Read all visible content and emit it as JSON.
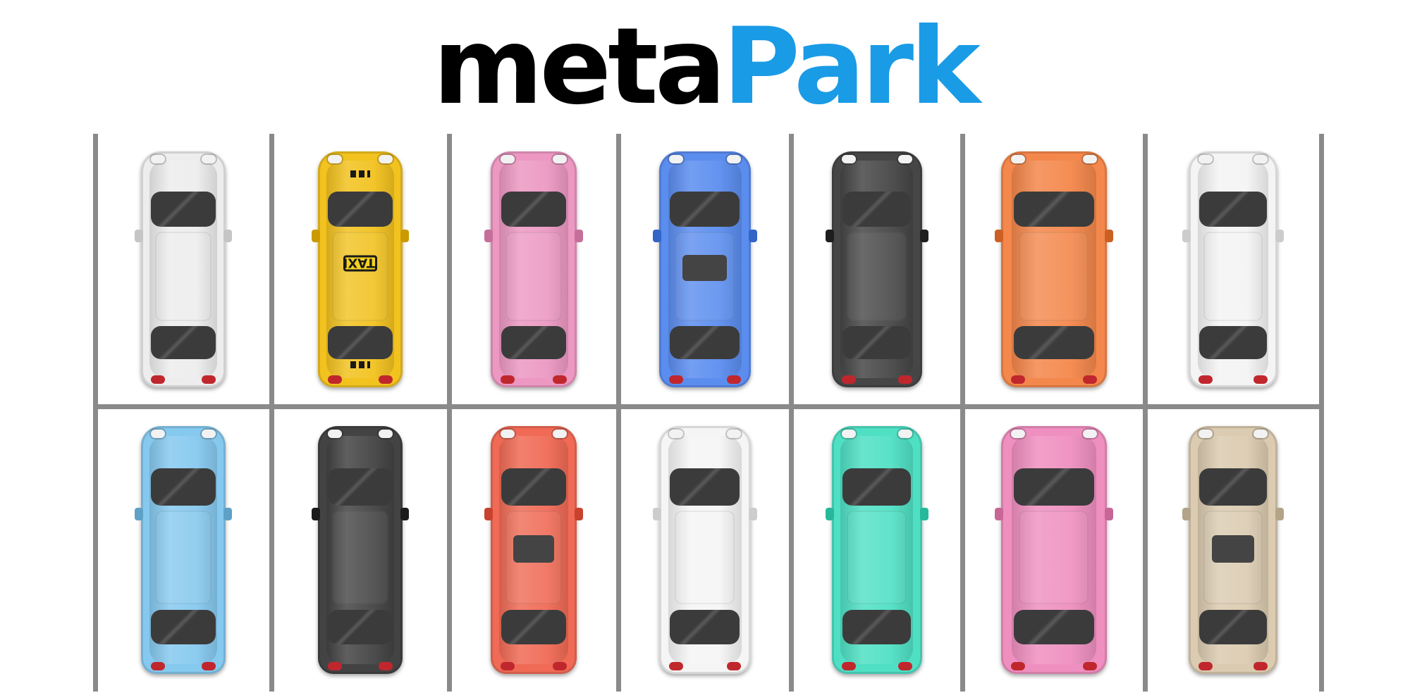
{
  "logo": {
    "part1": "meta",
    "part2": "Park",
    "color1": "#000000",
    "color2": "#1a9be6"
  },
  "taxi_sign_text": "TAXI",
  "lot": {
    "line_color": "#8a8a8a",
    "rows": [
      {
        "cars": [
          {
            "color": "#ededed",
            "icon": "white-coupe-car-icon"
          },
          {
            "color": "#f2c21f",
            "icon": "yellow-taxi-car-icon",
            "taxi": true
          },
          {
            "color": "#ec98c2",
            "icon": "pink-hatchback-car-icon"
          },
          {
            "color": "#5b8def",
            "icon": "blue-wagon-car-icon",
            "sunroof": true
          },
          {
            "color": "#464646",
            "icon": "black-hatchback-car-icon"
          },
          {
            "color": "#f4874b",
            "icon": "orange-van-car-icon"
          },
          {
            "color": "#f4f4f4",
            "icon": "white-sedan-car-icon"
          }
        ]
      },
      {
        "cars": [
          {
            "color": "#86c9ef",
            "icon": "light-blue-classic-car-icon"
          },
          {
            "color": "#434343",
            "icon": "black-hatchback-car-icon"
          },
          {
            "color": "#f06a55",
            "icon": "red-sedan-car-icon",
            "sunroof": true
          },
          {
            "color": "#f5f5f5",
            "icon": "white-hatchback-car-icon"
          },
          {
            "color": "#4fe0c4",
            "icon": "teal-beetle-car-icon"
          },
          {
            "color": "#ef8fc0",
            "icon": "pink-hatchback-car-icon"
          },
          {
            "color": "#dbcbb0",
            "icon": "beige-suv-car-icon",
            "sunroof": true
          }
        ]
      }
    ]
  }
}
